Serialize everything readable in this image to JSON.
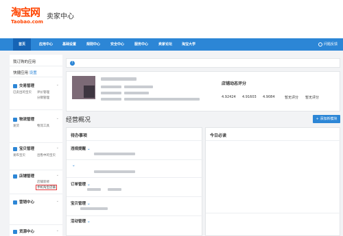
{
  "brand": {
    "logo_main": "淘宝网",
    "logo_sub": "Taobao.com",
    "title": "卖家中心"
  },
  "nav": {
    "items": [
      "首页",
      "应用中心",
      "基础设置",
      "规则中心",
      "安全中心",
      "服务中心",
      "卖家论坛",
      "淘宝大学"
    ],
    "help": "问题反馈"
  },
  "sidebar": {
    "my_apps": "我订购的应用",
    "quick_apps": "快捷应用",
    "settings_link": "设置",
    "sections": [
      {
        "title": "交易管理",
        "items": [
          "已卖出的宝贝",
          "评价管理",
          "",
          "分销管理",
          "",
          ""
        ]
      },
      {
        "title": "物流管理",
        "items": [
          "发货",
          "物流工具",
          "",
          "",
          "",
          ""
        ]
      },
      {
        "title": "宝贝管理",
        "items": [
          "发布宝贝",
          "出售中的宝贝",
          "",
          "",
          "",
          ""
        ]
      },
      {
        "title": "店铺管理",
        "items": [
          "",
          "店铺装修",
          "",
          "手机淘宝店铺"
        ]
      },
      {
        "title": "营销中心",
        "items": [
          "",
          "",
          "",
          "",
          "",
          ""
        ]
      },
      {
        "title": "货源中心",
        "items": []
      }
    ]
  },
  "notice": {
    "text": "",
    "link": ""
  },
  "score": {
    "title": "店铺动态评分",
    "headers": [
      "",
      "",
      "",
      "",
      "",
      ""
    ],
    "values": [
      "4.92424",
      "4.91603",
      "4.9084",
      "暂无评分",
      "暂无评分",
      ""
    ],
    "delta": ""
  },
  "overview": {
    "title": "经营概况",
    "guide": "",
    "add_button": "+ 添加新模块"
  },
  "todo": {
    "title": "待办事项",
    "groups": [
      "违规提醒",
      "",
      "订单管理",
      "宝贝管理",
      "活动管理"
    ],
    "remaining": ""
  },
  "today": {
    "title": "今日必读",
    "tabs": [
      "",
      ""
    ],
    "news": [
      {
        "title": "",
        "date": "",
        "lines": [
          "",
          "",
          "",
          ""
        ]
      },
      {
        "title": "",
        "date": "",
        "lines": [
          "",
          "",
          "",
          ""
        ]
      }
    ],
    "biz_title": ""
  }
}
